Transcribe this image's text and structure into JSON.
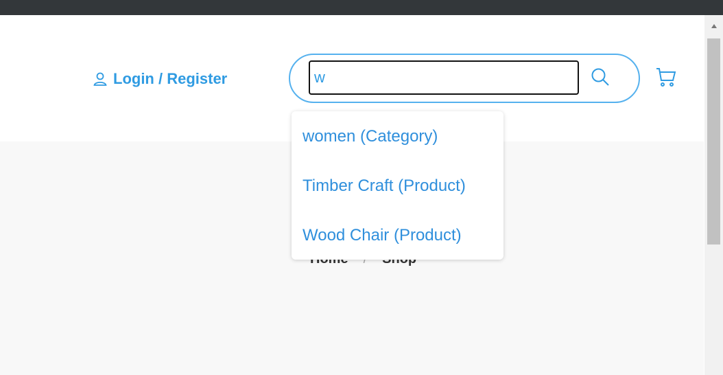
{
  "header": {
    "login_label": "Login / Register",
    "login_icon": "user-icon",
    "search": {
      "value": "w",
      "icon": "search-icon"
    },
    "cart_icon": "cart-icon"
  },
  "suggestions": [
    "women (Category)",
    "Timber Craft (Product)",
    "Wood Chair (Product)"
  ],
  "breadcrumb": {
    "home": "Home",
    "separator": "/",
    "current": "Shop"
  },
  "colors": {
    "accent": "#2f9be2",
    "topbar": "#33373a",
    "content_bg": "#f8f8f8"
  }
}
